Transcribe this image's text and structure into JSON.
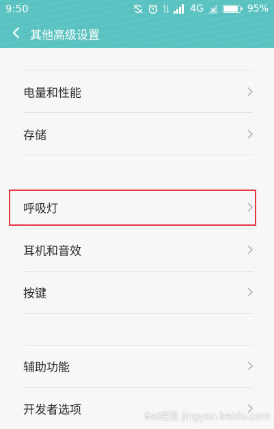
{
  "status_bar": {
    "time": "9:50",
    "network": "4G",
    "battery": "95%",
    "battery_level": 0.95
  },
  "header": {
    "title": "其他高级设置",
    "back_icon": "back-chevron-icon"
  },
  "items": [
    {
      "label": "电量和性能"
    },
    {
      "label": "存储"
    },
    {
      "label": "呼吸灯"
    },
    {
      "label": "耳机和音效"
    },
    {
      "label": "按键"
    },
    {
      "label": "辅助功能"
    },
    {
      "label": "开发者选项"
    }
  ],
  "watermark": "Bai经验 jingyan.baidu.com",
  "colors": {
    "accent": "#5ac3c1",
    "highlight": "#e8363f"
  }
}
